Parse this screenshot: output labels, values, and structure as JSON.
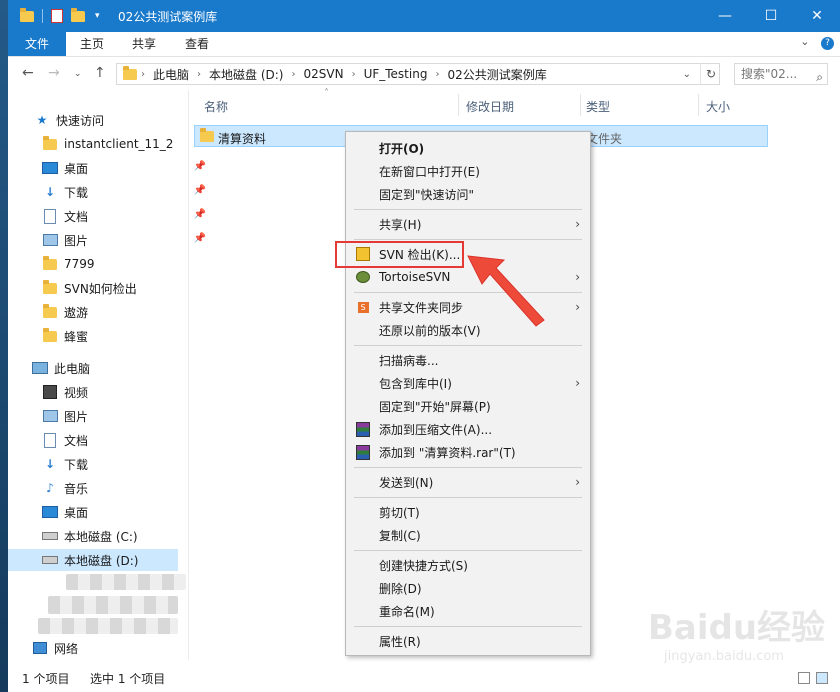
{
  "window": {
    "title": "02公共测试案例库",
    "controls": {
      "minimize": "—",
      "maximize": "☐",
      "close": "✕"
    }
  },
  "ribbon": {
    "tabs": [
      {
        "label": "文件",
        "active": true
      },
      {
        "label": "主页"
      },
      {
        "label": "共享"
      },
      {
        "label": "查看"
      }
    ]
  },
  "address": {
    "crumbs": [
      "此电脑",
      "本地磁盘 (D:)",
      "02SVN",
      "UF_Testing",
      "02公共测试案例库"
    ],
    "search_placeholder": "搜索\"02..."
  },
  "nav": {
    "quick_access": "快速访问",
    "quick_items": [
      {
        "label": "instantclient_11_2",
        "icon": "folder-icon",
        "pinned": true
      },
      {
        "label": "桌面",
        "icon": "desktop-icon",
        "pinned": true
      },
      {
        "label": "下载",
        "icon": "download-icon",
        "pinned": true
      },
      {
        "label": "文档",
        "icon": "document-icon",
        "pinned": true
      },
      {
        "label": "图片",
        "icon": "picture-icon",
        "pinned": true
      },
      {
        "label": "7799",
        "icon": "folder-icon"
      },
      {
        "label": "SVN如何检出",
        "icon": "folder-icon"
      },
      {
        "label": "遨游",
        "icon": "folder-icon"
      },
      {
        "label": "蜂蜜",
        "icon": "folder-icon"
      }
    ],
    "this_pc": "此电脑",
    "pc_items": [
      {
        "label": "视频",
        "icon": "video-icon"
      },
      {
        "label": "图片",
        "icon": "picture-icon"
      },
      {
        "label": "文档",
        "icon": "document-icon"
      },
      {
        "label": "下载",
        "icon": "download-icon"
      },
      {
        "label": "音乐",
        "icon": "music-icon"
      },
      {
        "label": "桌面",
        "icon": "desktop-icon"
      },
      {
        "label": "本地磁盘 (C:)",
        "icon": "drive-icon"
      },
      {
        "label": "本地磁盘 (D:)",
        "icon": "drive-icon",
        "selected": true
      }
    ],
    "network": "网络"
  },
  "columns": {
    "name": "名称",
    "modified": "修改日期",
    "type": "类型",
    "size": "大小"
  },
  "files": [
    {
      "name": "清算资料",
      "type": "文件夹"
    }
  ],
  "status": {
    "count": "1 个项目",
    "selected": "选中 1 个项目"
  },
  "context_menu": [
    {
      "label": "打开(O)",
      "bold": true
    },
    {
      "label": "在新窗口中打开(E)"
    },
    {
      "label": "固定到\"快速访问\""
    },
    {
      "sep": true
    },
    {
      "label": "共享(H)",
      "submenu": true
    },
    {
      "sep": true
    },
    {
      "label": "SVN 检出(K)...",
      "icon": "svn-checkout-icon"
    },
    {
      "label": "TortoiseSVN",
      "icon": "tortoisesvn-icon",
      "submenu": true
    },
    {
      "sep": true
    },
    {
      "label": "共享文件夹同步",
      "icon": "sync-icon",
      "submenu": true
    },
    {
      "label": "还原以前的版本(V)"
    },
    {
      "sep": true
    },
    {
      "label": "扫描病毒..."
    },
    {
      "label": "包含到库中(I)",
      "submenu": true
    },
    {
      "label": "固定到\"开始\"屏幕(P)"
    },
    {
      "label": "添加到压缩文件(A)...",
      "icon": "winrar-icon"
    },
    {
      "label": "添加到 \"清算资料.rar\"(T)",
      "icon": "winrar-icon"
    },
    {
      "sep": true
    },
    {
      "label": "发送到(N)",
      "submenu": true
    },
    {
      "sep": true
    },
    {
      "label": "剪切(T)"
    },
    {
      "label": "复制(C)"
    },
    {
      "sep": true
    },
    {
      "label": "创建快捷方式(S)"
    },
    {
      "label": "删除(D)"
    },
    {
      "label": "重命名(M)"
    },
    {
      "sep": true
    },
    {
      "label": "属性(R)"
    }
  ],
  "watermark": {
    "brand": "Baidu经验",
    "url": "jingyan.baidu.com"
  },
  "colors": {
    "accent": "#1979ca",
    "selection": "#cce8ff",
    "highlight": "#e53935"
  }
}
